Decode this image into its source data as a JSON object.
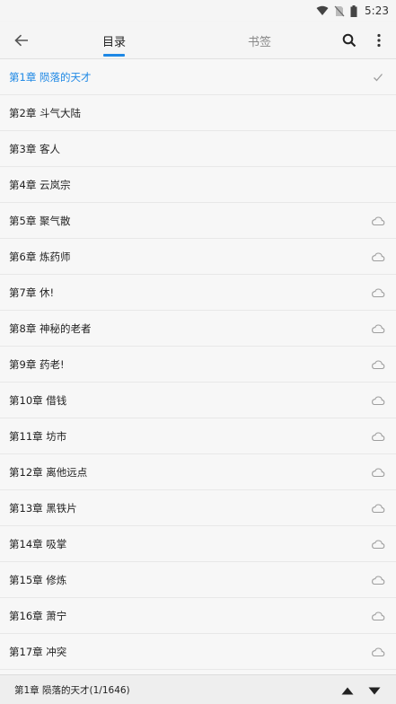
{
  "status_bar": {
    "time": "5:23"
  },
  "toolbar": {
    "tabs": [
      {
        "label": "目录",
        "active": true
      },
      {
        "label": "书签",
        "active": false
      }
    ],
    "icons": {
      "back": "arrow-left-icon",
      "search": "search-icon",
      "more": "more-vert-icon"
    }
  },
  "chapters": [
    {
      "title": "第1章 陨落的天才",
      "state": "current"
    },
    {
      "title": "第2章 斗气大陆",
      "state": "cached"
    },
    {
      "title": "第3章 客人",
      "state": "cached"
    },
    {
      "title": "第4章 云岚宗",
      "state": "cached"
    },
    {
      "title": "第5章 聚气散",
      "state": "cloud"
    },
    {
      "title": "第6章 炼药师",
      "state": "cloud"
    },
    {
      "title": "第7章 休!",
      "state": "cloud"
    },
    {
      "title": "第8章 神秘的老者",
      "state": "cloud"
    },
    {
      "title": "第9章 药老!",
      "state": "cloud"
    },
    {
      "title": "第10章 借钱",
      "state": "cloud"
    },
    {
      "title": "第11章 坊市",
      "state": "cloud"
    },
    {
      "title": "第12章 离他远点",
      "state": "cloud"
    },
    {
      "title": "第13章 黑铁片",
      "state": "cloud"
    },
    {
      "title": "第14章 吸掌",
      "state": "cloud"
    },
    {
      "title": "第15章 修炼",
      "state": "cloud"
    },
    {
      "title": "第16章 萧宁",
      "state": "cloud"
    },
    {
      "title": "第17章 冲突",
      "state": "cloud"
    }
  ],
  "bottom_bar": {
    "current_chapter": "第1章 陨落的天才(1/1646)"
  },
  "colors": {
    "accent": "#1e88e5",
    "icon_gray": "#9e9e9e",
    "background": "#f5f5f5"
  }
}
